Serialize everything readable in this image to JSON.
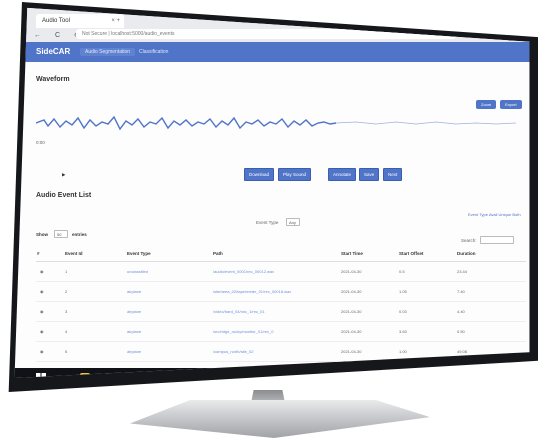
{
  "browser": {
    "tab_title": "Audio Tool",
    "tab_close": "× +",
    "nav_glyphs": "← C ⊕",
    "url": "Not Secure | localhost:5000/audio_events"
  },
  "navbar": {
    "brand": "SideCAR",
    "links": [
      "Audio Segmentation",
      "Classification"
    ]
  },
  "waveform": {
    "title": "Waveform",
    "buttons": [
      "Zoom",
      "Export"
    ],
    "start_label": "0:00",
    "play_glyph": "▶"
  },
  "controls": {
    "buttons": [
      "Download",
      "Play Sound",
      "Annotate",
      "Save",
      "Next"
    ]
  },
  "events": {
    "title": "Audio Event List",
    "filter_links": "Event Type Avail Unique  Both",
    "event_type_label": "Event Type",
    "event_type_value": "Any",
    "show_label": "Show",
    "show_value": "50",
    "entries_label": "entries",
    "search_label": "Search:",
    "columns": [
      "#",
      "Event Id",
      "Event Type",
      "Path",
      "Start Time",
      "Start Offset",
      "Duration"
    ],
    "rows": [
      {
        "id": "1",
        "type": "unclassified",
        "path": "/audio/event_0001/rec_00012.wav",
        "start": "2021-04-30",
        "offset": "0.5",
        "dur": "23.44"
      },
      {
        "id": "2",
        "type": "airplane",
        "path": "/site/area_02/tape/meter_01/rec_00018.wav",
        "start": "2021-04-30",
        "offset": "1.05",
        "dur": "7.40"
      },
      {
        "id": "3",
        "type": "airplane",
        "path": "/video/hard_04/mic_1/rec_01",
        "start": "2021-04-30",
        "offset": "0.03",
        "dur": "4.40"
      },
      {
        "id": "4",
        "type": "airplane",
        "path": "/src/ridge_rocky/monitor_01/rec_0",
        "start": "2021-04-30",
        "offset": "3.63",
        "dur": "0.50"
      },
      {
        "id": "5",
        "type": "airplane",
        "path": "/campus_north/site_02",
        "start": "2021-04-30",
        "offset": "1.00",
        "dur": "49.08"
      },
      {
        "id": "6",
        "type": "airplane",
        "path": "/south_shore/bridge_system",
        "start": "2021-04-30",
        "offset": "69.02",
        "dur": "20.34"
      },
      {
        "id": "7",
        "type": "airplane",
        "path": "/metro/central_02/node_4/rec_0004",
        "start": "2021-04-30",
        "offset": "58.02",
        "dur": "14.80"
      }
    ]
  },
  "colors": {
    "accent": "#4f74c8",
    "navbar": "#4f74c8",
    "link": "#6d8fd8",
    "taskbar": "#101218"
  },
  "icons": {
    "start": "windows-logo-icon",
    "taskbar": [
      "folder-icon",
      "chrome-icon"
    ]
  }
}
